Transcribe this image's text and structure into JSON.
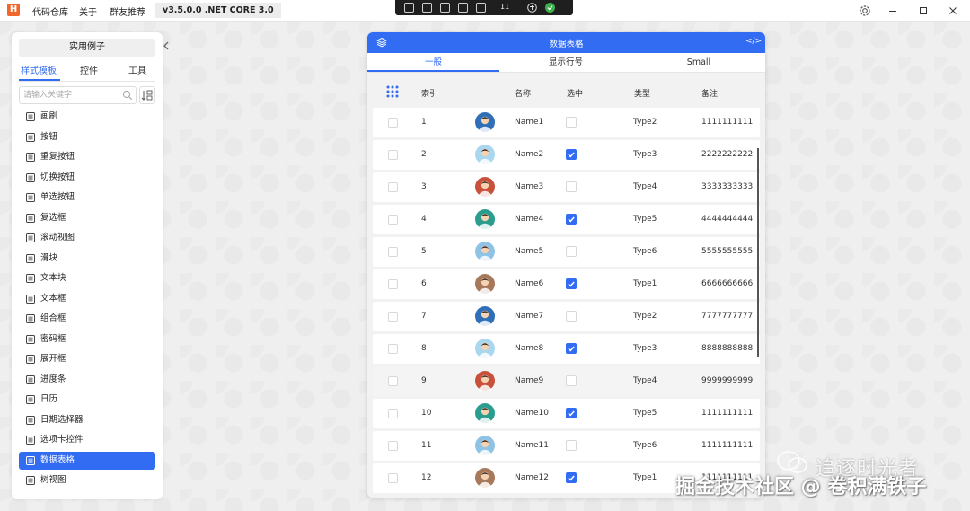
{
  "titlebar": {
    "logo": "H",
    "menu": [
      "代码仓库",
      "关于",
      "群友推荐"
    ],
    "version": "v3.5.0.0 .NET CORE 3.0",
    "debug_count": "11"
  },
  "left_panel": {
    "title": "实用例子",
    "tabs": [
      "样式模板",
      "控件",
      "工具"
    ],
    "active_tab": 0,
    "search_placeholder": "请输入关键字",
    "items": [
      {
        "label": "画刷",
        "icon": "brush-icon"
      },
      {
        "label": "按钮",
        "icon": "button-icon"
      },
      {
        "label": "重复按钮",
        "icon": "repeat-button-icon"
      },
      {
        "label": "切换按钮",
        "icon": "toggle-button-icon"
      },
      {
        "label": "单选按钮",
        "icon": "radio-button-icon"
      },
      {
        "label": "复选框",
        "icon": "checkbox-icon"
      },
      {
        "label": "滚动视图",
        "icon": "scrollview-icon"
      },
      {
        "label": "滑块",
        "icon": "slider-icon"
      },
      {
        "label": "文本块",
        "icon": "textblock-icon"
      },
      {
        "label": "文本框",
        "icon": "textbox-icon"
      },
      {
        "label": "组合框",
        "icon": "combobox-icon"
      },
      {
        "label": "密码框",
        "icon": "passwordbox-icon"
      },
      {
        "label": "展开框",
        "icon": "expander-icon"
      },
      {
        "label": "进度条",
        "icon": "progressbar-icon"
      },
      {
        "label": "日历",
        "icon": "calendar-icon"
      },
      {
        "label": "日期选择器",
        "icon": "datepicker-icon"
      },
      {
        "label": "选项卡控件",
        "icon": "tabcontrol-icon"
      },
      {
        "label": "数据表格",
        "icon": "datagrid-icon"
      },
      {
        "label": "树视图",
        "icon": "treeview-icon"
      }
    ],
    "active_item": 17
  },
  "card": {
    "title": "数据表格",
    "code_label": "</>",
    "tabs": [
      "一般",
      "显示行号",
      "Small"
    ],
    "active_tab": 0,
    "columns": [
      "索引",
      "名称",
      "选中",
      "类型",
      "备注"
    ],
    "rows": [
      {
        "index": "1",
        "name": "Name1",
        "checked": false,
        "type": "Type2",
        "note": "1111111111",
        "avatar": "#2f6fb8"
      },
      {
        "index": "2",
        "name": "Name2",
        "checked": true,
        "type": "Type3",
        "note": "2222222222",
        "avatar": "#a9d7ef"
      },
      {
        "index": "3",
        "name": "Name3",
        "checked": false,
        "type": "Type4",
        "note": "3333333333",
        "avatar": "#c9503b"
      },
      {
        "index": "4",
        "name": "Name4",
        "checked": true,
        "type": "Type5",
        "note": "4444444444",
        "avatar": "#2a9d8f"
      },
      {
        "index": "5",
        "name": "Name5",
        "checked": false,
        "type": "Type6",
        "note": "5555555555",
        "avatar": "#8ec3e6"
      },
      {
        "index": "6",
        "name": "Name6",
        "checked": true,
        "type": "Type1",
        "note": "6666666666",
        "avatar": "#a7785a"
      },
      {
        "index": "7",
        "name": "Name7",
        "checked": false,
        "type": "Type2",
        "note": "7777777777",
        "avatar": "#2f6fb8"
      },
      {
        "index": "8",
        "name": "Name8",
        "checked": true,
        "type": "Type3",
        "note": "8888888888",
        "avatar": "#a9d7ef"
      },
      {
        "index": "9",
        "name": "Name9",
        "checked": false,
        "type": "Type4",
        "note": "9999999999",
        "avatar": "#c9503b"
      },
      {
        "index": "10",
        "name": "Name10",
        "checked": true,
        "type": "Type5",
        "note": "1111111111",
        "avatar": "#2a9d8f"
      },
      {
        "index": "11",
        "name": "Name11",
        "checked": false,
        "type": "Type6",
        "note": "1111111111",
        "avatar": "#8ec3e6"
      },
      {
        "index": "12",
        "name": "Name12",
        "checked": true,
        "type": "Type1",
        "note": "1111111111",
        "avatar": "#a7785a"
      }
    ],
    "hover_row": 8
  },
  "watermark": {
    "top": "追逐时光者",
    "bottom": "掘金技术社区 @ 卷积满铁子"
  },
  "colors": {
    "accent": "#326cf3",
    "logo": "#f2662a"
  }
}
